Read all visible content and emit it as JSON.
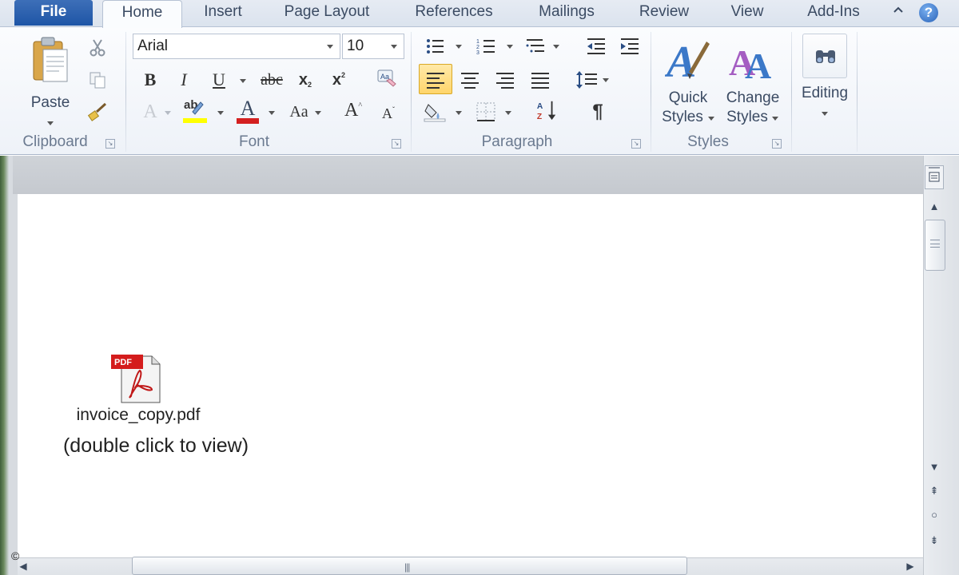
{
  "tabs": [
    {
      "label": "File"
    },
    {
      "label": "Home"
    },
    {
      "label": "Insert"
    },
    {
      "label": "Page Layout"
    },
    {
      "label": "References"
    },
    {
      "label": "Mailings"
    },
    {
      "label": "Review"
    },
    {
      "label": "View"
    },
    {
      "label": "Add-Ins"
    }
  ],
  "active_tab": "Home",
  "ribbon": {
    "clipboard": {
      "label": "Clipboard",
      "paste_label": "Paste"
    },
    "font": {
      "label": "Font",
      "font_name": "Arial",
      "font_size": "10",
      "bold": "B",
      "italic": "I",
      "underline": "U",
      "strikethrough": "abc",
      "subscript": "x",
      "superscript": "x",
      "text_effects": "A",
      "highlight": "ab",
      "font_color": "A",
      "change_case": "Aa",
      "grow_font": "A",
      "shrink_font": "A"
    },
    "paragraph": {
      "label": "Paragraph",
      "show_marks": "¶"
    },
    "styles": {
      "label": "Styles",
      "quick_line1": "Quick",
      "quick_line2": "Styles",
      "change_line1": "Change",
      "change_line2": "Styles"
    },
    "editing": {
      "label": "Editing"
    }
  },
  "document": {
    "attachment_filename": "invoice_copy.pdf",
    "attachment_icon_label": "PDF",
    "attachment_hint": "(double click to view)"
  },
  "corner_mark": "©",
  "colors": {
    "file_tab": "#2a5fae",
    "highlight_yellow": "#ffff00",
    "font_color_red": "#d42020",
    "active_align_bg": "#ffd56b"
  }
}
